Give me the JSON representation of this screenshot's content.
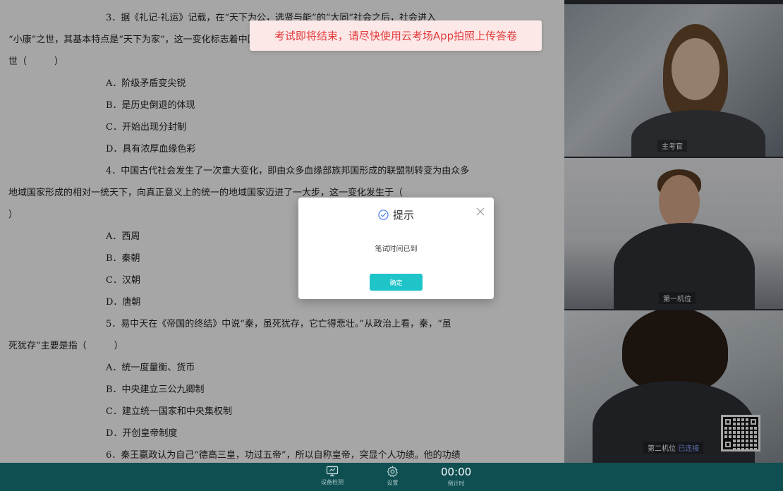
{
  "toast": {
    "text": "考试即将结束，请尽快使用云考场App拍照上传答卷"
  },
  "paper": {
    "lines": [
      {
        "text": "3．据《礼记·礼运》记载，在“天下为公，选贤与能”的“大同”社会之后，社会进入",
        "style": "indent"
      },
      {
        "text": "“小康”之世，其基本特点是“天下为家”，这一变化标志着中国历史进入了一个新时",
        "style": "flush"
      },
      {
        "text": "世（　　　）",
        "style": "flush"
      },
      {
        "text": "A．阶级矛盾变尖锐",
        "style": "opt"
      },
      {
        "text": "B．是历史倒退的体现",
        "style": "opt"
      },
      {
        "text": "C．开始出现分封制",
        "style": "opt"
      },
      {
        "text": "D．具有浓厚血缘色彩",
        "style": "opt"
      },
      {
        "text": "4．中国古代社会发生了一次重大变化，即由众多血缘部族邦国形成的联盟制转变为由众多",
        "style": "indent"
      },
      {
        "text": "地域国家形成的相对一统天下，向真正意义上的统一的地域国家迈进了一大步，这一变化发生于（",
        "style": "flush"
      },
      {
        "text": "）",
        "style": "flush"
      },
      {
        "text": "A．西周",
        "style": "opt"
      },
      {
        "text": "B．秦朝",
        "style": "opt"
      },
      {
        "text": "C．汉朝",
        "style": "opt"
      },
      {
        "text": "D．唐朝",
        "style": "opt"
      },
      {
        "text": "5．易中天在《帝国的终结》中说“秦，虽死犹存，它亡得悲壮。”从政治上看，秦，“虽",
        "style": "indent"
      },
      {
        "text": "死犹存”主要是指（　　　）",
        "style": "flush"
      },
      {
        "text": "A．统一度量衡、货币",
        "style": "opt"
      },
      {
        "text": "B．中央建立三公九卿制",
        "style": "opt"
      },
      {
        "text": "C．建立统一国家和中央集权制",
        "style": "opt"
      },
      {
        "text": "D．开创皇帝制度",
        "style": "opt"
      },
      {
        "text": "6．秦王嬴政认为自己“德高三皇，功过五帝”，所以自称皇帝，突显个人功绩。他的功绩",
        "style": "indent"
      }
    ]
  },
  "videos": {
    "examiner_label": "主考官",
    "cam1_label": "第一机位",
    "cam2_label": "第二机位",
    "cam2_status": "已连接",
    "cam2_status_color": "#8ea7ff"
  },
  "modal": {
    "title": "提示",
    "message": "笔试时间已到",
    "confirm_label": "确定",
    "accent": "#1fc4c9"
  },
  "bottombar": {
    "device_check_label": "设备检测",
    "settings_label": "设置",
    "timer_value": "00:00",
    "timer_label": "倒计时"
  }
}
